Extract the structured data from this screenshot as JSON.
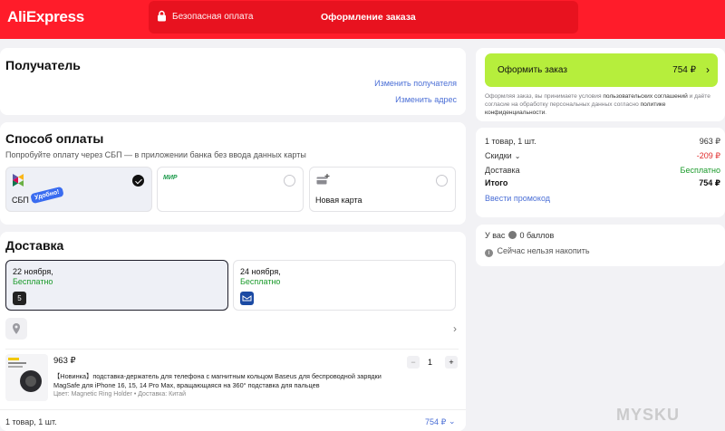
{
  "header": {
    "logo": "AliExpress",
    "secure": "Безопасная оплата",
    "title": "Оформление заказа"
  },
  "recipient": {
    "title": "Получатель",
    "change_recipient": "Изменить получателя",
    "change_address": "Изменить адрес"
  },
  "payment": {
    "title": "Способ оплаты",
    "subtitle": "Попробуйте оплату через СБП — в приложении банка без ввода данных карты",
    "options": [
      {
        "label": "СБП",
        "badge": "Удобно!",
        "selected": true
      },
      {
        "label": "",
        "brand": "МИР",
        "selected": false
      },
      {
        "label": "Новая карта",
        "selected": false
      }
    ]
  },
  "delivery": {
    "title": "Доставка",
    "options": [
      {
        "date": "22 ноября,",
        "price": "Бесплатно",
        "carrier": "5"
      },
      {
        "date": "24 ноября,",
        "price": "Бесплатно"
      }
    ],
    "item": {
      "price": "963 ₽",
      "title_line1": "【Новинка】подставка-держатель для телефона с магнитным кольцом Baseus для беспроводной зарядки",
      "title_line2": "MagSafe для iPhone 16, 15, 14 Pro Max, вращающаяся на 360° подставка для пальцев",
      "meta": "Цвет: Magnetic Ring Holder • Доставка: Китай",
      "qty": "1",
      "minus": "−",
      "plus": "+"
    },
    "footer_left": "1 товар, 1 шт.",
    "footer_right": "754 ₽"
  },
  "order": {
    "button_label": "Оформить заказ",
    "button_sum": "754 ₽",
    "terms_1": "Оформляя заказ, вы принимаете условия ",
    "terms_link1": "пользовательских соглашений",
    "terms_2": " и даёте согласие на обработку персональных данных согласно ",
    "terms_link2": "политике конфиденциальности",
    "terms_3": "."
  },
  "summary": {
    "items_label": "1 товар, 1 шт.",
    "items_value": "963 ₽",
    "discount_label": "Скидки",
    "discount_value": "-209 ₽",
    "delivery_label": "Доставка",
    "delivery_value": "Бесплатно",
    "total_label": "Итого",
    "total_value": "754 ₽",
    "promo": "Ввести промокод"
  },
  "bonus": {
    "prefix": "У вас",
    "points": "0 баллов",
    "note": "Сейчас нельзя накопить"
  },
  "watermark": "MYSKU",
  "colors": {
    "brand_red": "#ff1c2a",
    "accent_green": "#b6ee3c",
    "link_blue": "#4b6fd6",
    "discount_red": "#e02a2a",
    "free_green": "#1a9a2a"
  }
}
